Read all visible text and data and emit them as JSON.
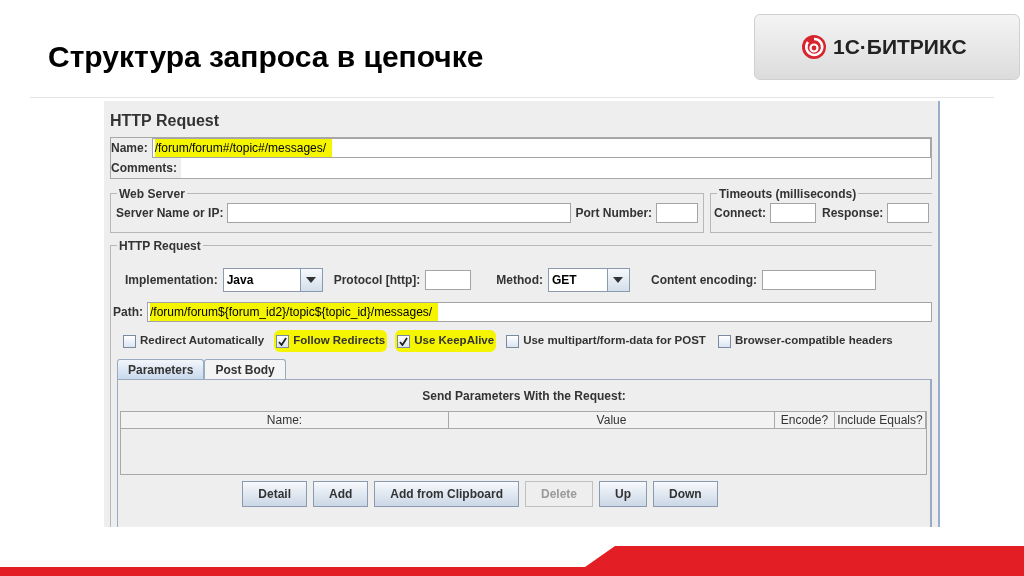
{
  "slide": {
    "title": "Структура запроса в цепочке",
    "logo": {
      "text": "1С·БИТРИКС"
    }
  },
  "panel": {
    "title": "HTTP Request",
    "name": {
      "label": "Name:",
      "value": "/forum/forum#/topic#/messages/",
      "highlighted": true
    },
    "comments": {
      "label": "Comments:"
    },
    "web_server": {
      "title": "Web Server",
      "fields": [
        {
          "label": "Server Name or IP:"
        },
        {
          "label": "Port Number:"
        }
      ]
    },
    "timeouts": {
      "title": "Timeouts (milliseconds)",
      "fields": [
        {
          "label": "Connect:"
        },
        {
          "label": "Response:"
        }
      ]
    },
    "http_request": {
      "title": "HTTP Request",
      "implementation": {
        "label": "Implementation:",
        "value": "Java"
      },
      "protocol": {
        "label": "Protocol [http]:"
      },
      "method": {
        "label": "Method:",
        "value": "GET"
      },
      "content_encoding": {
        "label": "Content encoding:"
      },
      "path": {
        "label": "Path:",
        "value": "/forum/forum${forum_id2}/topic${topic_id}/messages/",
        "highlighted": true
      },
      "options": [
        {
          "label": "Redirect Automatically",
          "checked": false,
          "highlighted": false
        },
        {
          "label": "Follow Redirects",
          "checked": true,
          "highlighted": true
        },
        {
          "label": "Use KeepAlive",
          "checked": true,
          "highlighted": true
        },
        {
          "label": "Use multipart/form-data for POST",
          "checked": false,
          "highlighted": false
        },
        {
          "label": "Browser-compatible headers",
          "checked": false,
          "highlighted": false
        }
      ]
    },
    "tabs": [
      {
        "label": "Parameters",
        "selected": true
      },
      {
        "label": "Post Body",
        "selected": false
      }
    ],
    "parameters": {
      "caption": "Send Parameters With the Request:",
      "columns": [
        "Name:",
        "Value",
        "Encode?",
        "Include Equals?"
      ],
      "buttons": [
        {
          "label": "Detail",
          "disabled": false
        },
        {
          "label": "Add",
          "disabled": false
        },
        {
          "label": "Add from Clipboard",
          "disabled": false
        },
        {
          "label": "Delete",
          "disabled": true
        },
        {
          "label": "Up",
          "disabled": false
        },
        {
          "label": "Down",
          "disabled": false
        }
      ]
    }
  }
}
